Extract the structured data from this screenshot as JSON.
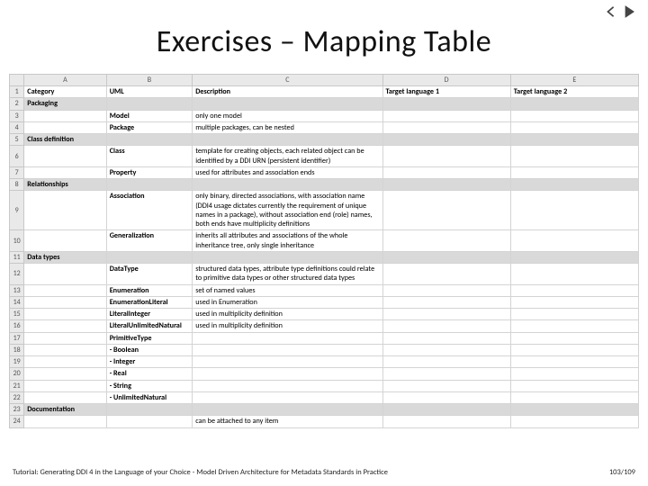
{
  "title": "Exercises – Mapping Table",
  "nav": {
    "prev": "prev",
    "next": "next"
  },
  "columns": {
    "letters": [
      "A",
      "B",
      "C",
      "D",
      "E"
    ],
    "headers": [
      "Category",
      "UML",
      "Description",
      "Target language 1",
      "Target language 2"
    ]
  },
  "rows": [
    {
      "n": 1,
      "type": "hdr"
    },
    {
      "n": 2,
      "type": "cat",
      "category": "Packaging"
    },
    {
      "n": 3,
      "type": "item",
      "uml": "Model",
      "desc": "only one model"
    },
    {
      "n": 4,
      "type": "item",
      "uml": "Package",
      "desc": "multiple packages, can be nested"
    },
    {
      "n": 5,
      "type": "cat",
      "category": "Class definition"
    },
    {
      "n": 6,
      "type": "item",
      "uml": "Class",
      "desc": "template for creating objects, each related object can be identified by a DDI URN (persistent identifier)"
    },
    {
      "n": 7,
      "type": "item",
      "uml": "Property",
      "desc": "used for attributes and association ends"
    },
    {
      "n": 8,
      "type": "cat",
      "category": "Relationships"
    },
    {
      "n": 9,
      "type": "item",
      "uml": "Association",
      "desc": "only binary, directed associations, with association name (DDI4 usage dictates currently the requirement of unique names in a package), without association end (role) names, both ends have multiplicity definitions"
    },
    {
      "n": 10,
      "type": "item",
      "uml": "Generalization",
      "desc": "inherits all attributes and associations of the whole inheritance tree, only single inheritance"
    },
    {
      "n": 11,
      "type": "cat",
      "category": "Data types"
    },
    {
      "n": 12,
      "type": "item",
      "uml": "DataType",
      "desc": "structured data types, attribute type definitions could relate to primitive data types or other structured data types"
    },
    {
      "n": 13,
      "type": "item",
      "uml": "Enumeration",
      "desc": "set of named values"
    },
    {
      "n": 14,
      "type": "item",
      "uml": "EnumerationLiteral",
      "desc": "used in Enumeration"
    },
    {
      "n": 15,
      "type": "item",
      "uml": "LiteralInteger",
      "desc": "used in multiplicity definition"
    },
    {
      "n": 16,
      "type": "item",
      "uml": "LiteralUnlimitedNatural",
      "desc": "used in multiplicity definition"
    },
    {
      "n": 17,
      "type": "item",
      "uml": "PrimitiveType",
      "desc": ""
    },
    {
      "n": 18,
      "type": "item",
      "uml": "- Boolean",
      "desc": ""
    },
    {
      "n": 19,
      "type": "item",
      "uml": "- Integer",
      "desc": ""
    },
    {
      "n": 20,
      "type": "item",
      "uml": "- Real",
      "desc": ""
    },
    {
      "n": 21,
      "type": "item",
      "uml": "- String",
      "desc": ""
    },
    {
      "n": 22,
      "type": "item",
      "uml": "- UnlimitedNatural",
      "desc": ""
    },
    {
      "n": 23,
      "type": "cat",
      "category": "Documentation"
    },
    {
      "n": 24,
      "type": "item",
      "uml": "",
      "desc": "can be attached to any item"
    }
  ],
  "footer": {
    "left": "Tutorial: Generating DDI 4 in the Language of your Choice - Model Driven Architecture for Metadata Standards in Practice",
    "right": "103/109"
  }
}
